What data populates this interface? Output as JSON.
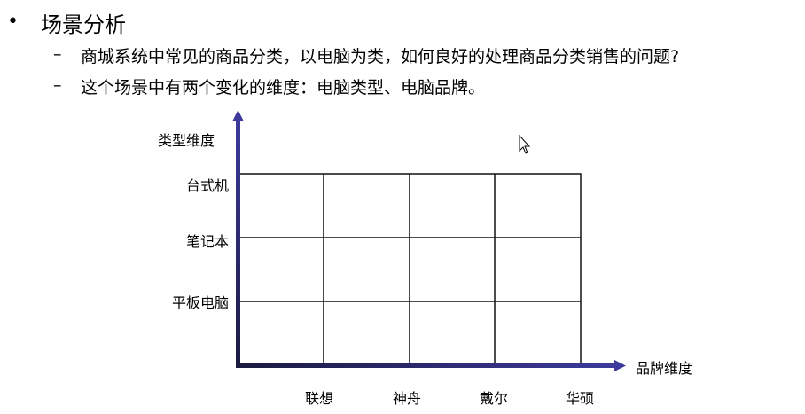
{
  "title": "场景分析",
  "bullets": [
    "商城系统中常见的商品分类，以电脑为类，如何良好的处理商品分类销售的问题?",
    "这个场景中有两个变化的维度：电脑类型、电脑品牌。"
  ],
  "diagram": {
    "y_axis_label": "类型维度",
    "x_axis_label": "品牌维度",
    "rows": [
      "台式机",
      "笔记本",
      "平板电脑"
    ],
    "columns": [
      "联想",
      "神舟",
      "戴尔",
      "华硕"
    ],
    "axis_color": "#3d3a9c"
  }
}
